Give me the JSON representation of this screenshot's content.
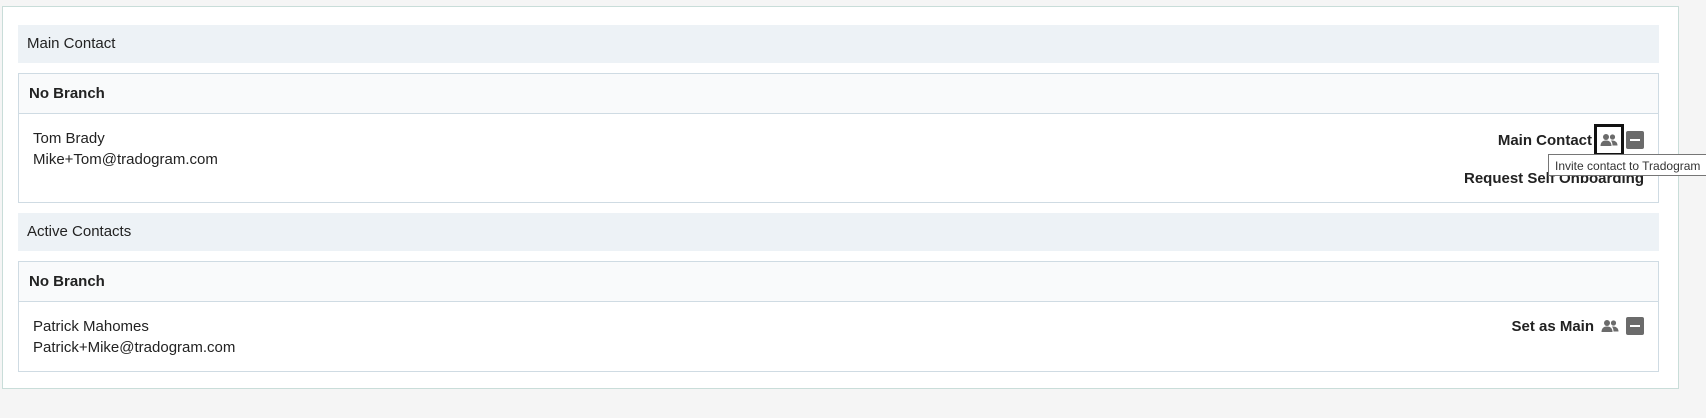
{
  "main_section": {
    "title": "Main Contact",
    "branch_title": "No Branch",
    "contact": {
      "name": "Tom Brady",
      "email": "Mike+Tom@tradogram.com",
      "status_label": "Main Contact",
      "secondary_action": "Request Self Onboarding"
    }
  },
  "active_section": {
    "title": "Active Contacts",
    "branch_title": "No Branch",
    "contact": {
      "name": "Patrick Mahomes",
      "email": "Patrick+Mike@tradogram.com",
      "action_label": "Set as Main"
    }
  },
  "tooltip": {
    "text": "Invite contact to Tradogram"
  },
  "icons": {
    "invite": "people-icon",
    "remove": "minus-square-icon"
  },
  "colors": {
    "section_header_bg": "#edf2f6",
    "icon_gray": "#6b6b6b"
  }
}
